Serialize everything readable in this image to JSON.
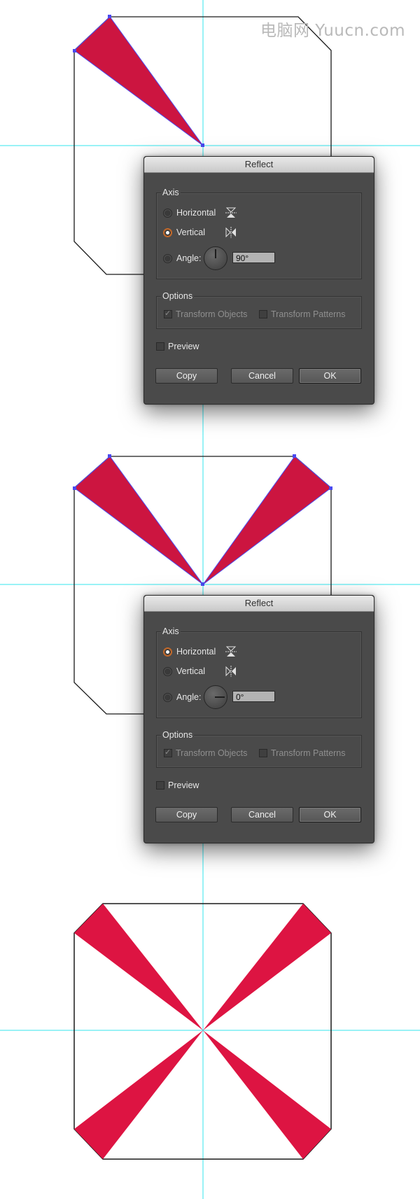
{
  "watermark": {
    "text": "电脑网 Yuucn.com"
  },
  "colors": {
    "guide": "#33e6ee",
    "fill": "#cc1540",
    "fill_final": "#dd1442",
    "selection": "#4a4af0",
    "dialog_bg": "#4a4a4a"
  },
  "dialogs": [
    {
      "title": "Reflect",
      "axis_label": "Axis",
      "horizontal_label": "Horizontal",
      "vertical_label": "Vertical",
      "angle_label": "Angle:",
      "angle_value": "90°",
      "selected_axis": "vertical",
      "horizontal_icon": "reflect-horizontal-icon",
      "vertical_icon": "reflect-vertical-icon",
      "options_label": "Options",
      "transform_objects": "Transform Objects",
      "transform_patterns": "Transform Patterns",
      "preview_label": "Preview",
      "copy_label": "Copy",
      "cancel_label": "Cancel",
      "ok_label": "OK"
    },
    {
      "title": "Reflect",
      "axis_label": "Axis",
      "horizontal_label": "Horizontal",
      "vertical_label": "Vertical",
      "angle_label": "Angle:",
      "angle_value": "0°",
      "selected_axis": "horizontal",
      "horizontal_icon": "reflect-horizontal-icon",
      "vertical_icon": "reflect-vertical-icon",
      "options_label": "Options",
      "transform_objects": "Transform Objects",
      "transform_patterns": "Transform Patterns",
      "preview_label": "Preview",
      "copy_label": "Copy",
      "cancel_label": "Cancel",
      "ok_label": "OK"
    }
  ]
}
